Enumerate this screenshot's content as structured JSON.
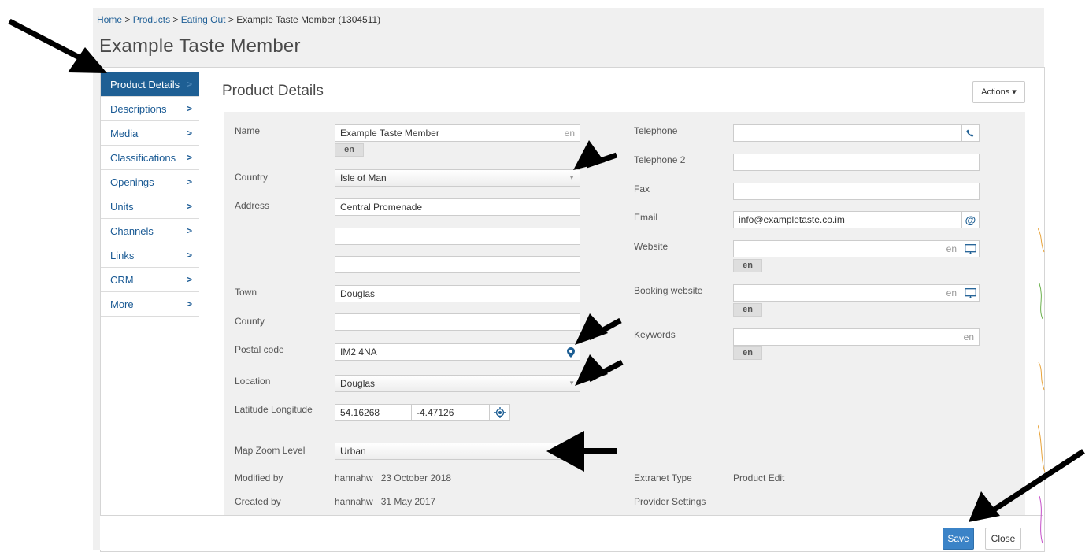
{
  "breadcrumb": {
    "home": "Home",
    "sep": ">",
    "products": "Products",
    "category": "Eating Out",
    "current": "Example Taste Member (1304511)"
  },
  "page_title": "Example Taste Member",
  "nav": {
    "items": [
      {
        "label": "Product Details",
        "active": true
      },
      {
        "label": "Descriptions"
      },
      {
        "label": "Media"
      },
      {
        "label": "Classifications"
      },
      {
        "label": "Openings"
      },
      {
        "label": "Units"
      },
      {
        "label": "Channels"
      },
      {
        "label": "Links"
      },
      {
        "label": "CRM"
      },
      {
        "label": "More"
      }
    ],
    "chevron": ">"
  },
  "panel": {
    "title": "Product Details",
    "actions_label": "Actions ▾"
  },
  "form": {
    "name": {
      "label": "Name",
      "value": "Example Taste Member",
      "lang": "en"
    },
    "country": {
      "label": "Country",
      "value": "Isle of Man"
    },
    "address": {
      "label": "Address",
      "line1": "Central Promenade",
      "line2": "",
      "line3": ""
    },
    "town": {
      "label": "Town",
      "value": "Douglas"
    },
    "county": {
      "label": "County",
      "value": ""
    },
    "postal_code": {
      "label": "Postal code",
      "value": "IM2 4NA"
    },
    "location": {
      "label": "Location",
      "value": "Douglas"
    },
    "latlng": {
      "label": "Latitude Longitude",
      "lat": "54.16268",
      "lng": "-4.47126"
    },
    "map_zoom": {
      "label": "Map Zoom Level",
      "value": "Urban"
    },
    "modified_by": {
      "label": "Modified by",
      "value": "hannahw   23 October 2018"
    },
    "created_by": {
      "label": "Created by",
      "value": "hannahw   31 May 2017"
    },
    "telephone": {
      "label": "Telephone",
      "value": ""
    },
    "telephone2": {
      "label": "Telephone 2",
      "value": ""
    },
    "fax": {
      "label": "Fax",
      "value": ""
    },
    "email": {
      "label": "Email",
      "value": "info@exampletaste.co.im"
    },
    "website": {
      "label": "Website",
      "value": "",
      "lang": "en"
    },
    "booking_website": {
      "label": "Booking website",
      "value": "",
      "lang": "en"
    },
    "keywords": {
      "label": "Keywords",
      "value": "",
      "lang": "en"
    },
    "extranet_type": {
      "label": "Extranet Type",
      "value": "Product Edit"
    },
    "provider_settings": {
      "label": "Provider Settings"
    }
  },
  "footer": {
    "save": "Save",
    "close": "Close"
  },
  "icons": {
    "phone": "phone-icon",
    "at": "at-icon",
    "monitor": "monitor-icon",
    "pin": "map-pin-icon",
    "target": "locate-icon"
  },
  "colors": {
    "accent": "#1e5f94",
    "save": "#3b83c7"
  }
}
